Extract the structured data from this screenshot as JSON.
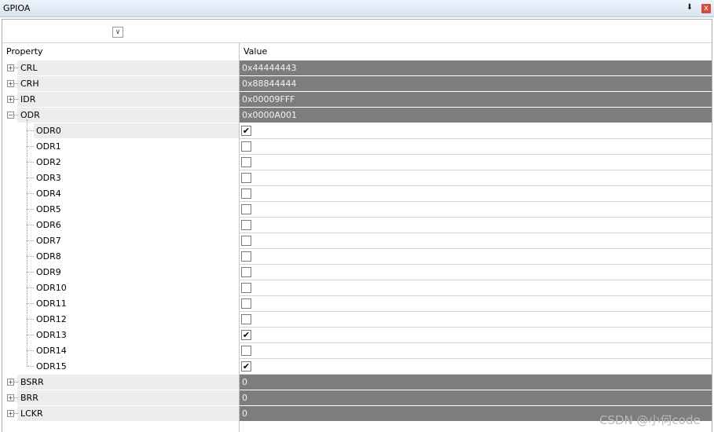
{
  "window": {
    "title": "GPIOA",
    "pin_glyph": "⬇",
    "close_glyph": "x"
  },
  "toolbar": {
    "dropdown_glyph": "∨"
  },
  "columns": {
    "property": "Property",
    "value": "Value"
  },
  "groups_top": [
    {
      "name": "CRL",
      "value": "0x44444443",
      "expander": "+"
    },
    {
      "name": "CRH",
      "value": "0x88844444",
      "expander": "+"
    },
    {
      "name": "IDR",
      "value": "0x00009FFF",
      "expander": "+"
    },
    {
      "name": "ODR",
      "value": "0x0000A001",
      "expander": "−"
    }
  ],
  "odr_bits": [
    {
      "name": "ODR0",
      "checked": true
    },
    {
      "name": "ODR1",
      "checked": false
    },
    {
      "name": "ODR2",
      "checked": false
    },
    {
      "name": "ODR3",
      "checked": false
    },
    {
      "name": "ODR4",
      "checked": false
    },
    {
      "name": "ODR5",
      "checked": false
    },
    {
      "name": "ODR6",
      "checked": false
    },
    {
      "name": "ODR7",
      "checked": false
    },
    {
      "name": "ODR8",
      "checked": false
    },
    {
      "name": "ODR9",
      "checked": false
    },
    {
      "name": "ODR10",
      "checked": false
    },
    {
      "name": "ODR11",
      "checked": false
    },
    {
      "name": "ODR12",
      "checked": false
    },
    {
      "name": "ODR13",
      "checked": true
    },
    {
      "name": "ODR14",
      "checked": false
    },
    {
      "name": "ODR15",
      "checked": true
    }
  ],
  "groups_bottom": [
    {
      "name": "BSRR",
      "value": "0",
      "expander": "+"
    },
    {
      "name": "BRR",
      "value": "0",
      "expander": "+"
    },
    {
      "name": "LCKR",
      "value": "0",
      "expander": "+"
    }
  ],
  "check_glyph": "✔",
  "watermark": "CSDN @小何code"
}
